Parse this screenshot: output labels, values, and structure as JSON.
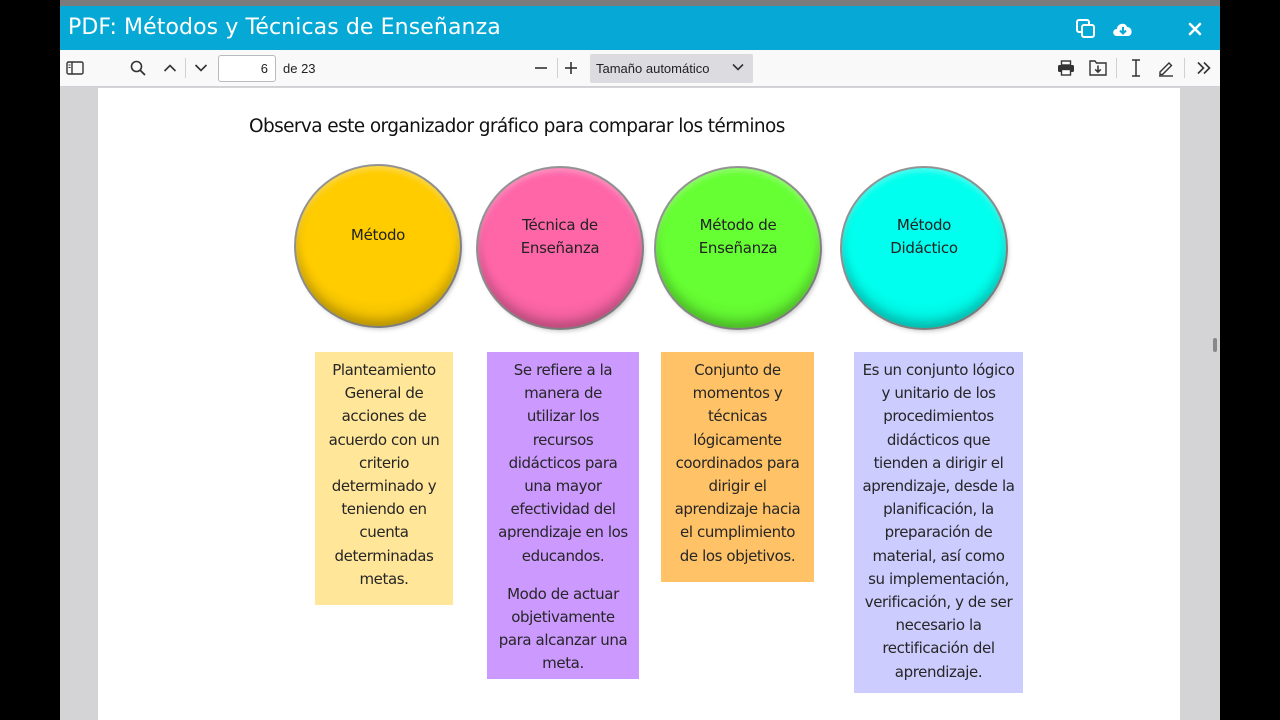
{
  "window": {
    "title": "PDF: Métodos y Técnicas de Enseñanza",
    "icons": [
      "copy-icon",
      "cloud-download-icon",
      "close-icon"
    ]
  },
  "toolbar": {
    "page_value": "6",
    "page_count": "de 23",
    "zoom_label": "Tamaño automático",
    "icons": [
      "sidebar-toggle-icon",
      "search-icon",
      "chevron-up-icon",
      "chevron-down-icon",
      "minus-icon",
      "plus-icon",
      "print-icon",
      "save-icon",
      "text-cursor-icon",
      "pencil-icon",
      "double-chevron-right-icon"
    ]
  },
  "document": {
    "heading": "Observa este organizador gráfico para comparar los términos",
    "circles": [
      {
        "label": "Método",
        "color": "#ffcc00"
      },
      {
        "label": "Técnica de Enseñanza",
        "color": "#ff66a8"
      },
      {
        "label": "Método de Enseñanza",
        "color": "#66ff33"
      },
      {
        "label": "Método Didáctico",
        "color": "#00ffee"
      }
    ],
    "boxes": [
      {
        "text": "Planteamiento General de acciones de acuerdo con un criterio determinado y teniendo en cuenta determinadas metas.",
        "color": "#ffe699"
      },
      {
        "text": "Se refiere a la manera de utilizar los recursos didácticos para una mayor efectividad del aprendizaje en los educandos.",
        "text2": "Modo de actuar objetivamente para alcanzar una meta.",
        "color": "#cc99ff"
      },
      {
        "text": "Conjunto de momentos y técnicas lógicamente coordinados para dirigir el aprendizaje hacia el cumplimiento de los objetivos.",
        "color": "#ffc266"
      },
      {
        "text": "Es un conjunto lógico y unitario de los procedimientos didácticos que tienden a dirigir el aprendizaje, desde la planificación, la preparación de material, así como su implementación, verificación, y de ser necesario la rectificación del aprendizaje.",
        "color": "#ccccff"
      }
    ]
  }
}
